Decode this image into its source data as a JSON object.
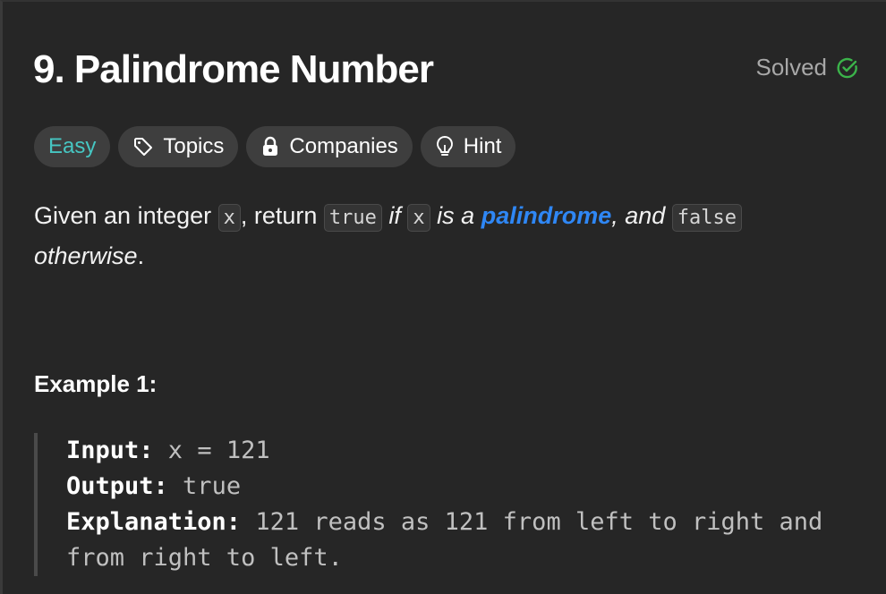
{
  "problem": {
    "title": "9. Palindrome Number",
    "status": "Solved",
    "status_color": "#3bb34a"
  },
  "tags": {
    "difficulty": "Easy",
    "difficulty_color": "#46c6c2",
    "topics": "Topics",
    "companies": "Companies",
    "hint": "Hint"
  },
  "description": {
    "t1": "Given an integer ",
    "code_x": "x",
    "t2": ", return ",
    "code_true": "true",
    "t3": " if ",
    "t4": " is a ",
    "link": "palindrome",
    "t5": ", and ",
    "code_false": "false",
    "t6": "otherwise",
    "t7": "."
  },
  "example": {
    "title": "Example 1:",
    "input_label": "Input:",
    "input_value": " x = 121",
    "output_label": "Output:",
    "output_value": " true",
    "explanation_label": "Explanation:",
    "explanation_value": " 121 reads as 121 from left to right and from right to left."
  }
}
